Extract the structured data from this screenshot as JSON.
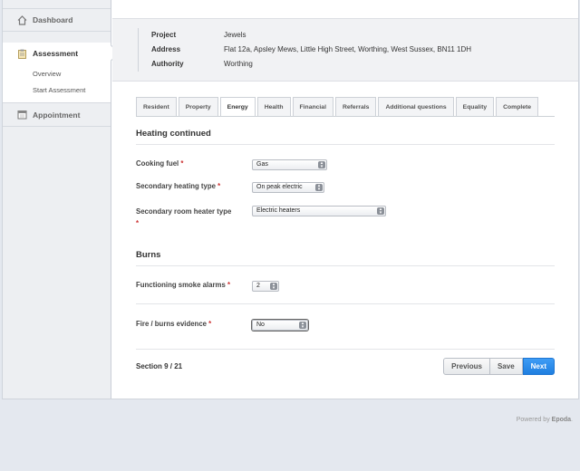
{
  "sidebar": {
    "dashboard_label": "Dashboard",
    "assessment_label": "Assessment",
    "subitems": [
      "Overview",
      "Start Assessment"
    ],
    "appointment_label": "Appointment"
  },
  "header": {
    "rows": [
      {
        "key": "Project",
        "value": "Jewels"
      },
      {
        "key": "Address",
        "value": "Flat 12a, Apsley Mews, Little High Street, Worthing, West Sussex, BN11 1DH"
      },
      {
        "key": "Authority",
        "value": "Worthing"
      }
    ]
  },
  "tabs": [
    "Resident",
    "Property",
    "Energy",
    "Health",
    "Financial",
    "Referrals",
    "Additional questions",
    "Equality",
    "Complete"
  ],
  "active_tab": "Energy",
  "sections": {
    "heating_title": "Heating continued",
    "burns_title": "Burns"
  },
  "fields": {
    "cooking_fuel": {
      "label": "Cooking fuel",
      "value": "Gas"
    },
    "secondary_heating_type": {
      "label": "Secondary heating type",
      "value": "On peak electric"
    },
    "secondary_room_heater_type": {
      "label": "Secondary room heater type",
      "value": "Electric heaters"
    },
    "functioning_smoke_alarms": {
      "label": "Functioning smoke alarms",
      "value": "2"
    },
    "fire_burns_evidence": {
      "label": "Fire / burns evidence",
      "value": "No"
    }
  },
  "required_marker": "*",
  "section_progress": "Section 9 / 21",
  "buttons": {
    "previous": "Previous",
    "save": "Save",
    "next": "Next"
  },
  "powered_by": {
    "prefix": "Powered by",
    "brand": "Epoda",
    "suffix": "."
  },
  "colors": {
    "accent": "#1f7fe0",
    "required": "#cc3333"
  }
}
